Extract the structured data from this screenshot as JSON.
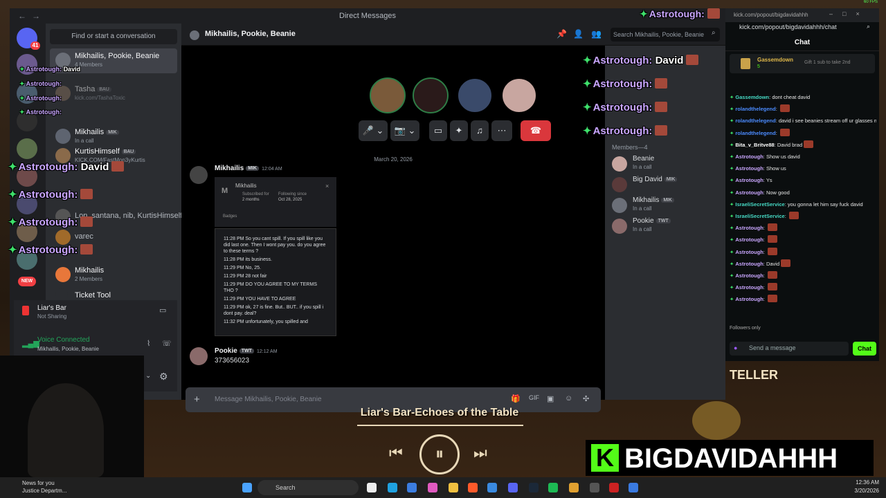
{
  "discord": {
    "window_title": "Direct Messages",
    "find_label": "Find or start a conversation",
    "guild_badge": "41",
    "dms": [
      {
        "name": "Mikhailis, Pookie, Beanie",
        "sub": "4 Members"
      },
      {
        "name": "Tasha",
        "tag": "BAU",
        "sub": "kick.com/TashaToxic"
      },
      {
        "name": "Mikhailis",
        "tag": "MIK",
        "sub": "In a call"
      },
      {
        "name": "KurtisHimself",
        "tag": "BAU",
        "sub": "KICK.COM/FastMon3yKurtis"
      },
      {
        "name": "Lon, santana, nib, KurtisHimself",
        "sub": ""
      },
      {
        "name": "varec",
        "sub": ""
      },
      {
        "name": "Mikhailis",
        "sub": "2 Members"
      },
      {
        "name": "Ticket Tool",
        "sub": ""
      }
    ],
    "voice_activity": {
      "name": "Liar's Bar",
      "status": "Not Sharing"
    },
    "voice_connected": {
      "label": "Voice Connected",
      "channel": "Mikhailis, Pookie, Beanie"
    },
    "new_badge": "NEW",
    "channel_header": "Mikhailis, Pookie, Beanie",
    "search_placeholder": "Search Mikhailis, Pookie, Beanie",
    "date_divider": "March 20, 2026",
    "messages": [
      {
        "author": "Mikhailis",
        "tag": "MIK",
        "time": "12:04 AM"
      },
      {
        "author": "Pookie",
        "tag": "TWT",
        "time": "12:12 AM",
        "text": "373656023"
      }
    ],
    "image_popup": {
      "name": "Mikhailis",
      "subscribed_label": "Subscribed for",
      "subscribed_value": "2 months",
      "following_label": "Following since",
      "following_value": "Oct 28, 2025",
      "badges_label": "Badges"
    },
    "image_log": [
      "11:28 PM So you cant spill. If you spill like you did last one. Then I wont pay you. do you agree to these terms ?",
      "11:28 PM its business.",
      "11:29 PM No, 25.",
      "11:29 PM 28 not fair",
      "11:29 PM DO YOU AGREE TO MY TERMS THO ?",
      "11:29 PM YOU HAVE TO AGREE",
      "11:29 PM ok, 27 is fine. But.. BUT.. if you spill i dont pay. deal?",
      "11:32 PM unfortunately, you spilled and"
    ],
    "composer_placeholder": "Message Mikhailis, Pookie, Beanie",
    "members_header": "Members—4",
    "members": [
      {
        "name": "Beanie",
        "tag": "",
        "status": "In a call"
      },
      {
        "name": "Big David",
        "tag": "MIK",
        "status": ""
      },
      {
        "name": "Mikhailis",
        "tag": "MIK",
        "status": "In a call"
      },
      {
        "name": "Pookie",
        "tag": "TWT",
        "status": "In a call"
      }
    ]
  },
  "kick": {
    "window_url": "kick.com/popout/bigdavidahhh",
    "address": "kick.com/popout/bigdavidahhh/chat",
    "header": "Chat",
    "pinned_user": "Gassemdown",
    "pinned_count": "5",
    "pinned_action": "Gift 1 sub to take 2nd",
    "lines": [
      {
        "user": "Gassemdown",
        "color": "#46d9c4",
        "text": "dont cheat david",
        "emote": false
      },
      {
        "user": "rolandthelegend",
        "color": "#4b8bff",
        "text": "",
        "emote": true
      },
      {
        "user": "rolandthelegend",
        "color": "#4b8bff",
        "text": "david i see beanies stream off ur glasses mud",
        "emote": false
      },
      {
        "user": "rolandthelegend",
        "color": "#4b8bff",
        "text": "",
        "emote": true
      },
      {
        "user": "Bita_v_Britve88",
        "color": "#ffffff",
        "text": "David brad",
        "emote": true
      },
      {
        "user": "Astrotough",
        "color": "#c9a6ff",
        "text": "Show us david",
        "emote": false
      },
      {
        "user": "Astrotough",
        "color": "#c9a6ff",
        "text": "Show us",
        "emote": false
      },
      {
        "user": "Astrotough",
        "color": "#c9a6ff",
        "text": "Ys",
        "emote": false
      },
      {
        "user": "Astrotough",
        "color": "#c9a6ff",
        "text": "Now good",
        "emote": false
      },
      {
        "user": "IsraeliSecretService",
        "color": "#46d9c4",
        "text": "you gonna let him say fuck david",
        "emote": false
      },
      {
        "user": "IsraeliSecretService",
        "color": "#46d9c4",
        "text": "",
        "emote": true
      },
      {
        "user": "Astrotough",
        "color": "#c9a6ff",
        "text": "",
        "emote": true
      },
      {
        "user": "Astrotough",
        "color": "#c9a6ff",
        "text": "",
        "emote": true
      },
      {
        "user": "Astrotough",
        "color": "#c9a6ff",
        "text": "",
        "emote": true
      },
      {
        "user": "Astrotough",
        "color": "#c9a6ff",
        "text": "David",
        "emote": true
      },
      {
        "user": "Astrotough",
        "color": "#c9a6ff",
        "text": "",
        "emote": true
      },
      {
        "user": "Astrotough",
        "color": "#c9a6ff",
        "text": "",
        "emote": true
      },
      {
        "user": "Astrotough",
        "color": "#c9a6ff",
        "text": "",
        "emote": true
      }
    ],
    "followers_only": "Followers only",
    "input_placeholder": "Send a message",
    "send_label": "Chat"
  },
  "overlay": {
    "user": "Astrotough:",
    "value": "David",
    "top_right": "Astrotough:"
  },
  "music": {
    "title": "Liar's Bar-Echoes of the Table",
    "prev": "⏮",
    "pause": "⏸",
    "next": "⏭"
  },
  "brand": {
    "letter": "K",
    "name": "BIGDAVIDAHHH"
  },
  "game_sign": "TELLER",
  "taskbar": {
    "news_title": "News for you",
    "news_sub": "Justice Departm...",
    "search_label": "Search",
    "time": "12:36 AM",
    "date": "3/20/2026"
  },
  "fps": "60 FPS",
  "colors": {
    "kick_green": "#53fc18",
    "discord_red": "#f23f43",
    "astro_name": "#c9a6ff"
  }
}
